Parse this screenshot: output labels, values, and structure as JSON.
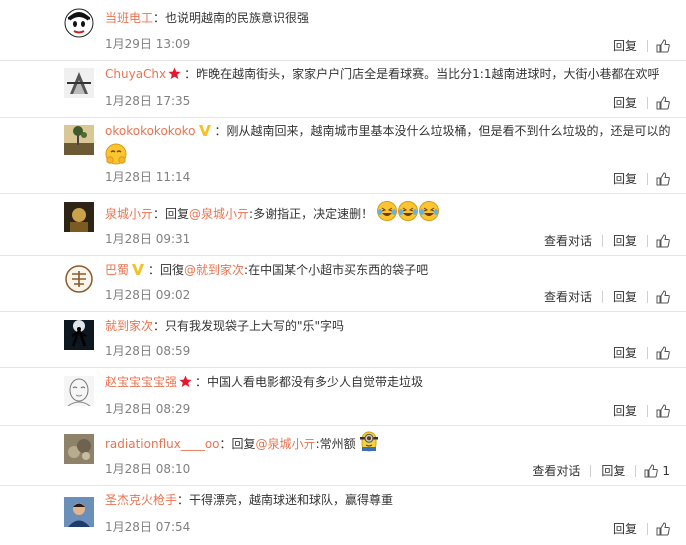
{
  "comments": [
    {
      "user": "当班电工",
      "text": "：也说明越南的民族意识很强",
      "time": "1月29日 13:09",
      "reply": "回复"
    },
    {
      "user": "ChuyaChx",
      "badge": "star",
      "text": "：昨晚在越南街头，家家户户门店全是看球赛。当比分1:1越南进球时，大街小巷都在欢呼",
      "time": "1月28日 17:35",
      "reply": "回复"
    },
    {
      "user": "okokokokokoko",
      "badge": "v",
      "text": "：刚从越南回来，越南城市里基本没什么垃圾桶，但是看不到什么垃圾的，还是可以的",
      "emoji": "hug-emoji",
      "time": "1月28日 11:14",
      "reply": "回复"
    },
    {
      "user": "泉城小亓",
      "text_before": "：回复",
      "mention": "@泉城小亓",
      "text_after": ":多谢指正，决定速删！",
      "emoji": "laughing-tears-emoji",
      "time": "1月28日 09:31",
      "view_thread": "查看对话",
      "reply": "回复"
    },
    {
      "user": "巴蜀",
      "badge": "v",
      "text_before": "：回復",
      "mention": "@就到家次",
      "text_after": ":在中国某个小超市买东西的袋子吧",
      "time": "1月28日 09:02",
      "view_thread": "查看对话",
      "reply": "回复"
    },
    {
      "user": "就到家次",
      "text": "：只有我发现袋子上大写的\"乐\"字吗",
      "time": "1月28日 08:59",
      "reply": "回复"
    },
    {
      "user": "赵宝宝宝宝强",
      "badge": "star",
      "text": "：中国人看电影都没有多少人自觉带走垃圾",
      "time": "1月28日 08:29",
      "reply": "回复"
    },
    {
      "user": "radiationflux____oo",
      "text_before": "：回复",
      "mention": "@泉城小亓",
      "text_after": ":常州额",
      "emoji": "minion-emoji",
      "time": "1月28日 08:10",
      "view_thread": "查看对话",
      "reply": "回复",
      "likes": "1"
    },
    {
      "user": "圣杰克火枪手",
      "text": "：干得漂亮，越南球迷和球队，赢得尊重",
      "time": "1月28日 07:54",
      "reply": "回复"
    }
  ],
  "colors": {
    "username": "#eb7350",
    "meta": "#808080",
    "badge_v": "#f6c027",
    "badge_star": "#e6162d"
  }
}
